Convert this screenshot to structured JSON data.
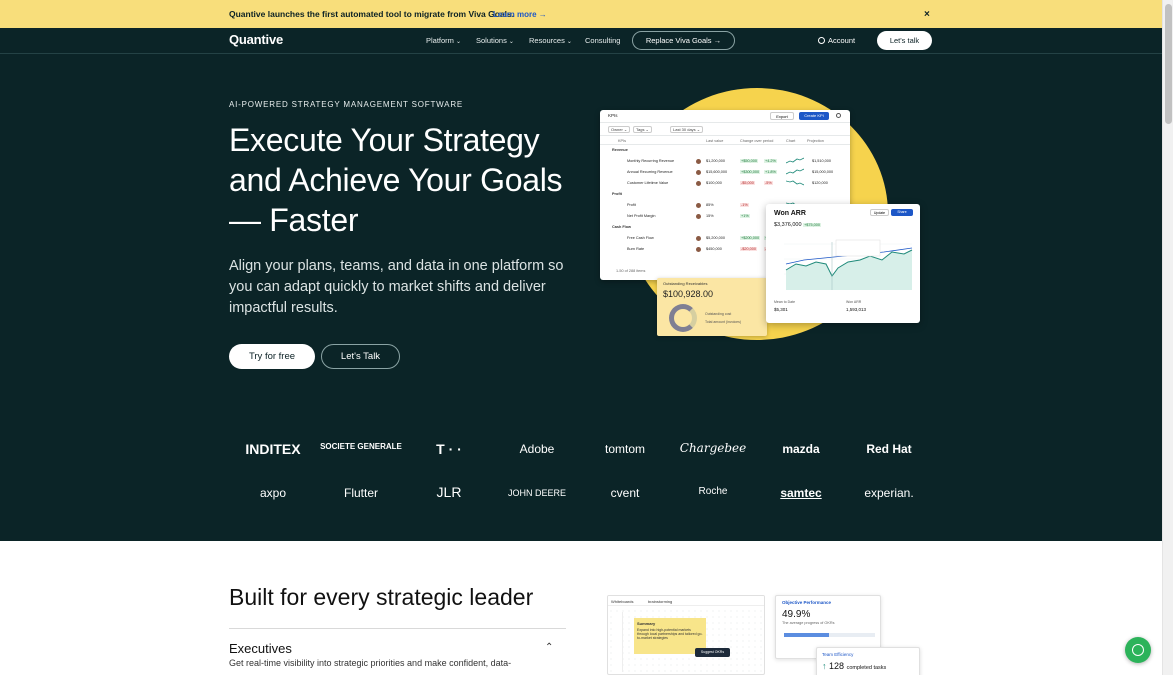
{
  "banner": {
    "message": "Quantive launches the first automated tool to migrate from Viva Goals.",
    "link": "Learn more →",
    "close": "×"
  },
  "nav": {
    "logo": "Quantive",
    "items": [
      "Platform",
      "Solutions",
      "Resources",
      "Consulting"
    ],
    "replace_button": "Replace Viva Goals →",
    "account": "Account",
    "talk_button": "Let's talk"
  },
  "hero": {
    "eyebrow": "AI-POWERED STRATEGY MANAGEMENT SOFTWARE",
    "headline": "Execute Your Strategy and Achieve Your Goals — Faster",
    "subtext": "Align your plans, teams, and data in one platform so you can adapt quickly to market shifts and deliver impactful results.",
    "try_button": "Try for free",
    "lets_talk_button": "Let's Talk"
  },
  "kpi_card": {
    "title": "KPIs",
    "export": "Export",
    "create": "Create KPI",
    "filters": [
      "Owner ⌄",
      "Tags ⌄",
      "Last 30 days ⌄"
    ],
    "columns": [
      "KPIs",
      "Last value",
      "Change over period",
      "Chart",
      "Projection"
    ],
    "groups": [
      {
        "name": "Revenue",
        "rows": [
          {
            "name": "Monthly Recurring Revenue",
            "value": "$1,200,000",
            "change": "+$50,000",
            "pct": "+4.2%",
            "trend": "up",
            "proj": "$1,510,000"
          },
          {
            "name": "Annual Recurring Revenue",
            "value": "$15,600,000",
            "change": "+$300,000",
            "pct": "+1.8%",
            "trend": "up",
            "proj": "$15,000,000"
          },
          {
            "name": "Customer Lifetime Value",
            "value": "$100,000",
            "change": "-$5,000",
            "pct": "-5%",
            "trend": "down",
            "proj": "$120,000"
          }
        ]
      },
      {
        "name": "Profit",
        "rows": [
          {
            "name": "Profit",
            "value": "85%",
            "change": "-1%",
            "pct": "",
            "trend": "down",
            "proj": ""
          },
          {
            "name": "Net Profit Margin",
            "value": "15%",
            "change": "+1%",
            "pct": "",
            "trend": "up",
            "proj": ""
          }
        ]
      },
      {
        "name": "Cash Flow",
        "rows": [
          {
            "name": "Free Cash Flow",
            "value": "$5,200,000",
            "change": "+$200,000",
            "pct": "+4%",
            "trend": "up",
            "proj": ""
          },
          {
            "name": "Burn Rate",
            "value": "$450,000",
            "change": "-$20,000",
            "pct": "-4.3%",
            "trend": "up",
            "proj": ""
          }
        ]
      }
    ],
    "footer": "1-50 of 288 items"
  },
  "receivables_card": {
    "label": "Outstanding Receivables",
    "value": "$100,928.00",
    "legend": [
      "Outstanding cost",
      "Total amount (invoices)"
    ]
  },
  "arr_card": {
    "title": "Won ARR",
    "value": "$3,376,000",
    "change": "+$75,000",
    "update": "Update",
    "share": "Share",
    "footer_left_label": "Mean to Date",
    "footer_left_value": "$5,301",
    "footer_right_label": "Won ARR",
    "footer_right_value": "1,593,013"
  },
  "logos": {
    "row1": [
      "INDITEX",
      "SOCIETE GENERALE",
      "T · ·",
      "Adobe",
      "tomtom",
      "Chargebee",
      "mazda",
      "Red Hat"
    ],
    "row2": [
      "axpo",
      "Flutter",
      "JLR",
      "JOHN DEERE",
      "cvent",
      "Roche",
      "samtec",
      "experian."
    ]
  },
  "section2": {
    "title": "Built for every strategic leader",
    "executives": "Executives",
    "executives_desc": "Get real-time visibility into strategic priorities and make confident, data-",
    "whiteboard_title": "Whiteboards",
    "whiteboard_name": "brainstorming",
    "note_title": "Summary",
    "note_text": "Expand into high-potential markets through local partnerships and tailored go-to-market strategies",
    "tooltip": "Suggest OKRs",
    "objective_title": "Objective Performance",
    "objective_value": "49.9%",
    "objective_desc": "The average progress of OKRs",
    "team_title": "Team Efficiency",
    "team_value": "128",
    "team_value_suffix": "completed tasks"
  },
  "colors": {
    "dark_bg": "#0b2427",
    "banner_bg": "#f8de7b",
    "accent_blue": "#1d57c7",
    "sun_yellow": "#f6d34d",
    "chat_green": "#2cb35a"
  }
}
